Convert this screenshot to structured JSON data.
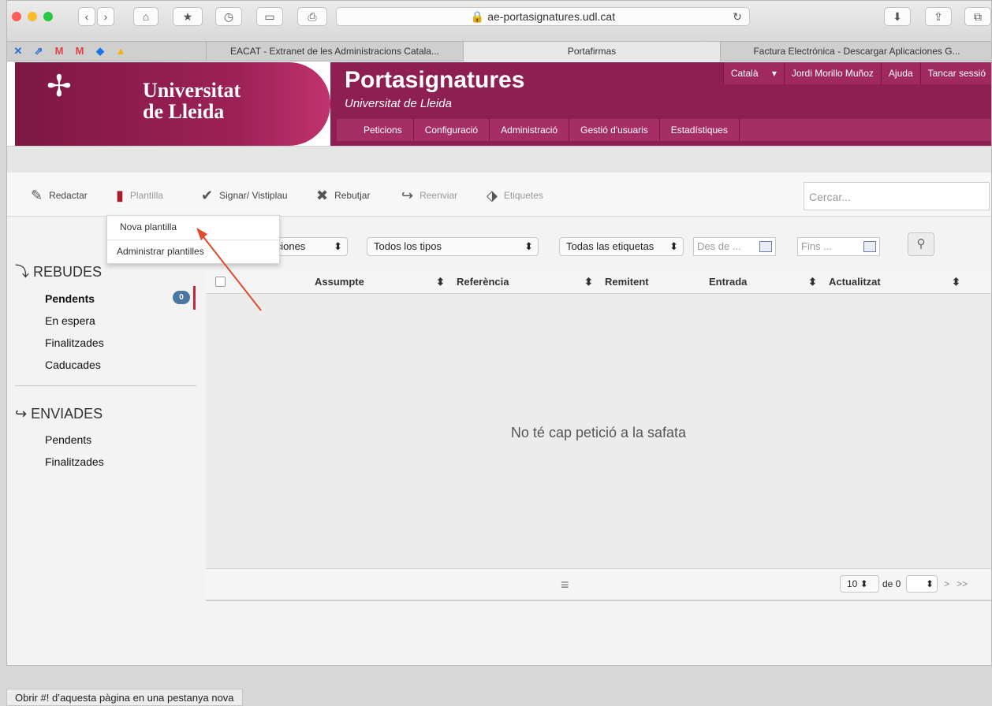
{
  "browser": {
    "url": "ae-portasignatures.udl.cat",
    "tabs": [
      {
        "label": "EACAT - Extranet de les Administracions Catala..."
      },
      {
        "label": "Portafirmas"
      },
      {
        "label": "Factura Electrónica - Descargar Aplicaciones G..."
      }
    ],
    "status_text": "Obrir #! d’aquesta pàgina en una pestanya nova"
  },
  "header": {
    "logo_text_1": "Universitat",
    "logo_text_2": "de Lleida",
    "app_title": "Portasignatures",
    "app_subtitle": "Universitat de Lleida",
    "top_nav": [
      "Català",
      "Jordi Morillo Muñoz",
      "Ajuda",
      "Tancar sessió"
    ],
    "main_nav": [
      "Peticions",
      "Configuració",
      "Administració",
      "Gestió d'usuaris",
      "Estadístiques"
    ]
  },
  "toolbar": {
    "redactar": "Redactar",
    "plantilla": "Plantilla",
    "signar": "Signar/ Vistiplau",
    "rebutjar": "Rebutjar",
    "reenviar": "Reenviar",
    "etiquetes": "Etiquetes",
    "search_placeholder": "Cercar..."
  },
  "dropdown": {
    "items": [
      "Nova plantilla",
      "Administrar plantilles"
    ]
  },
  "filters": {
    "apps": "caciones",
    "types": "Todos los tipos",
    "tags": "Todas las etiquetas",
    "from": "Des de ...",
    "to": "Fins ..."
  },
  "sidebar": {
    "rebudes": "REBUDES",
    "rebudes_items": [
      "Pendents",
      "En espera",
      "Finalitzades",
      "Caducades"
    ],
    "pending_count": "0",
    "enviades": "ENVIADES",
    "enviades_items": [
      "Pendents",
      "Finalitzades"
    ]
  },
  "table": {
    "columns": [
      "Assumpte",
      "Referència",
      "Remitent",
      "Entrada",
      "Actualitzat"
    ],
    "empty_message": "No té cap petició a la safata"
  },
  "pagination": {
    "page_size": "10",
    "of_label": "de 0",
    "next": ">",
    "last": ">>"
  }
}
